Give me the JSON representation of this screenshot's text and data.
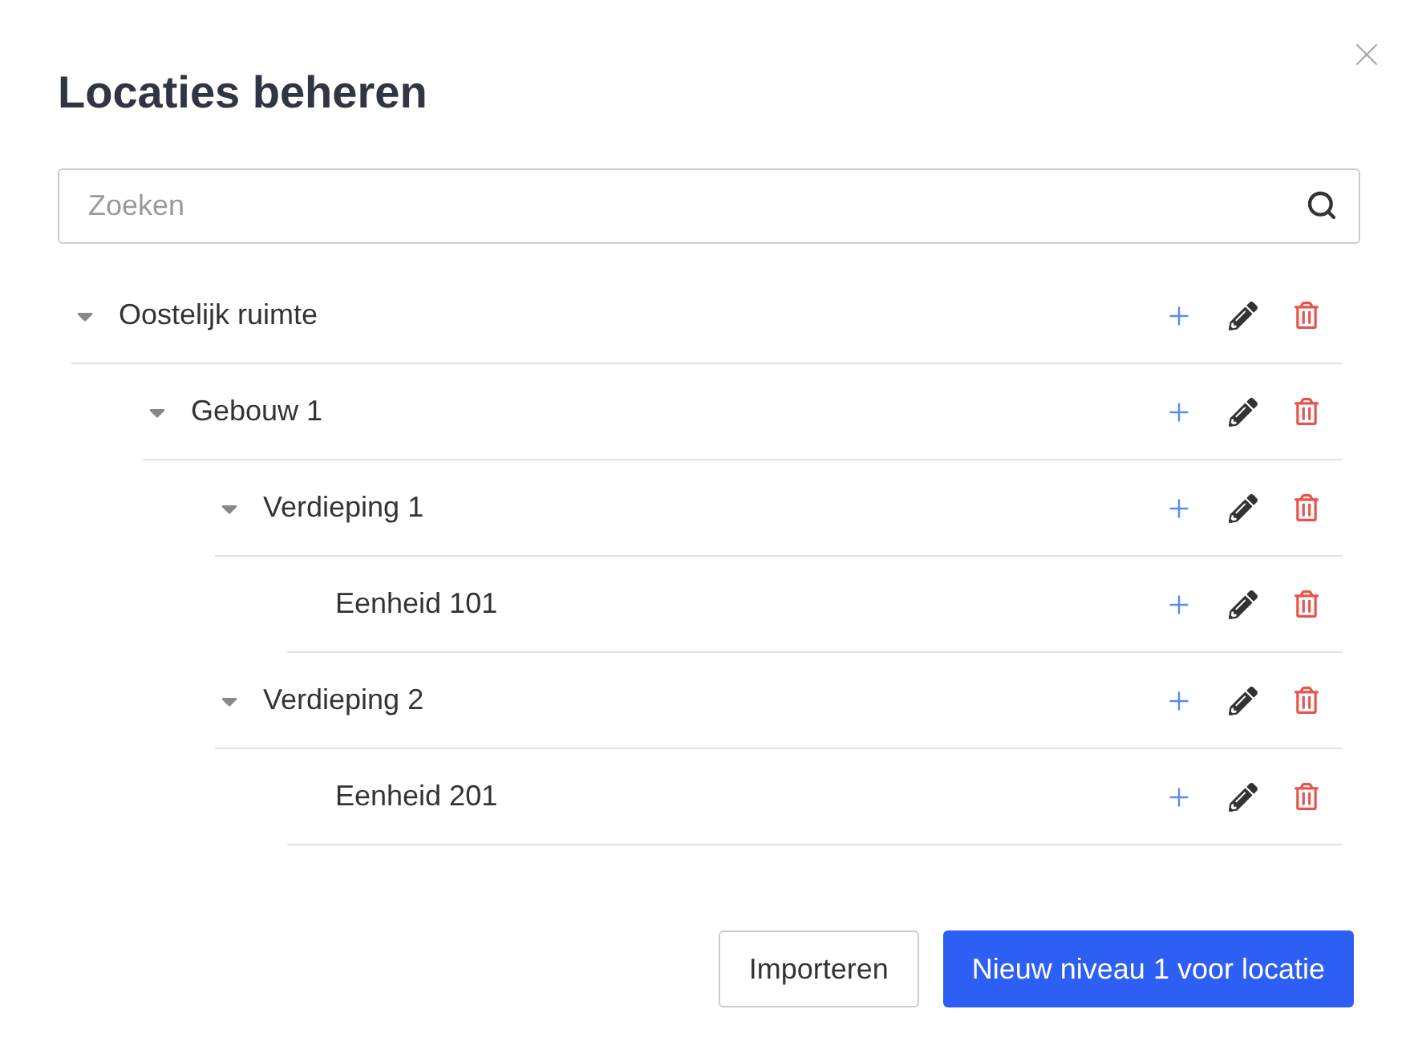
{
  "dialog": {
    "title": "Locaties beheren",
    "search": {
      "placeholder": "Zoeken"
    },
    "tree": [
      {
        "label": "Oostelijk ruimte",
        "expanded": true,
        "children": [
          {
            "label": "Gebouw 1",
            "expanded": true,
            "children": [
              {
                "label": "Verdieping 1",
                "expanded": true,
                "children": [
                  {
                    "label": "Eenheid 101"
                  }
                ]
              },
              {
                "label": "Verdieping 2",
                "expanded": true,
                "children": [
                  {
                    "label": "Eenheid 201"
                  }
                ]
              }
            ]
          }
        ]
      }
    ],
    "buttons": [
      {
        "label": "Importeren",
        "kind": "secondary"
      },
      {
        "label": "Nieuw niveau 1 voor locatie",
        "kind": "primary"
      }
    ]
  }
}
